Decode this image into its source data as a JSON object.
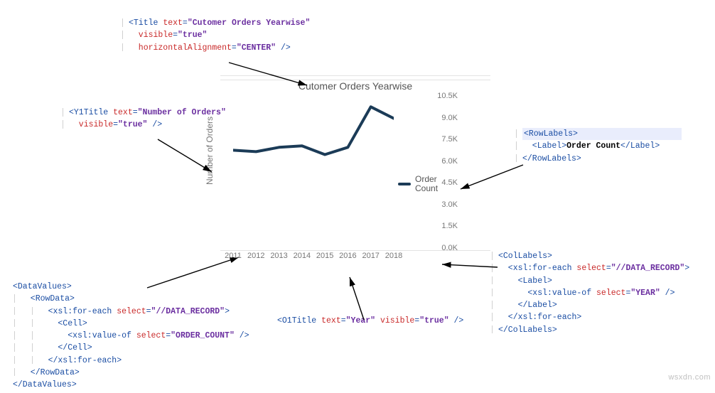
{
  "chart_data": {
    "type": "line",
    "title": "Cutomer Orders Yearwise",
    "ylabel": "Number of Orders",
    "xlabel": "Year",
    "legend": [
      "Order Count"
    ],
    "categories": [
      "2011",
      "2012",
      "2013",
      "2014",
      "2015",
      "2016",
      "2017",
      "2018"
    ],
    "values": [
      6800,
      6700,
      7000,
      7100,
      6500,
      7000,
      9800,
      9000
    ],
    "yticks": [
      "10.5K",
      "9.0K",
      "7.5K",
      "6.0K",
      "4.5K",
      "3.0K",
      "1.5K",
      "0.0K"
    ],
    "ylim": [
      0,
      10500
    ]
  },
  "annotations": {
    "title_code": {
      "l1_open": "<Title ",
      "l1_a1": "text",
      "l1_v1": "\"Cutomer Orders Yearwise\"",
      "l2_a": "visible",
      "l2_v": "\"true\"",
      "l3_a": "horizontalAlignment",
      "l3_v": "\"CENTER\"",
      "l3_close": " />"
    },
    "y1title": {
      "open": "<Y1Title ",
      "a1": "text",
      "v1": "\"Number of Orders\"",
      "a2": "visible",
      "v2": "\"true\"",
      "close": " />"
    },
    "rowlabels": {
      "open": "<RowLabels>",
      "label_open": "<Label>",
      "label_text": "Order Count",
      "label_close": "</Label>",
      "close": "</RowLabels>"
    },
    "datavalues": {
      "dv_open": "<DataValues>",
      "rd_open": "<RowData>",
      "fe_open": "<xsl:for-each ",
      "fe_attr": "select",
      "fe_val": "\"//DATA_RECORD\"",
      "fe_end": ">",
      "cell_open": "<Cell>",
      "vo_open": "<xsl:value-of ",
      "vo_attr": "select",
      "vo_val": "\"ORDER_COUNT\"",
      "vo_end": " />",
      "cell_close": "</Cell>",
      "fe_close": "</xsl:for-each>",
      "rd_close": "</RowData>",
      "dv_close": "</DataValues>"
    },
    "o1title": {
      "open": "<O1Title ",
      "a1": "text",
      "v1": "\"Year\"",
      "a2": "visible",
      "v2": "\"true\"",
      "close": " />"
    },
    "collabels": {
      "open": "<ColLabels>",
      "fe_open": "<xsl:for-each ",
      "fe_attr": "select",
      "fe_val": "\"//DATA_RECORD\"",
      "fe_end": ">",
      "lab_open": "<Label>",
      "vo_open": "<xsl:value-of ",
      "vo_attr": "select",
      "vo_val": "\"YEAR\"",
      "vo_end": " />",
      "lab_close": "</Label>",
      "fe_close": "</xsl:for-each>",
      "close": "</ColLabels>"
    }
  },
  "watermark": "wsxdn.com"
}
